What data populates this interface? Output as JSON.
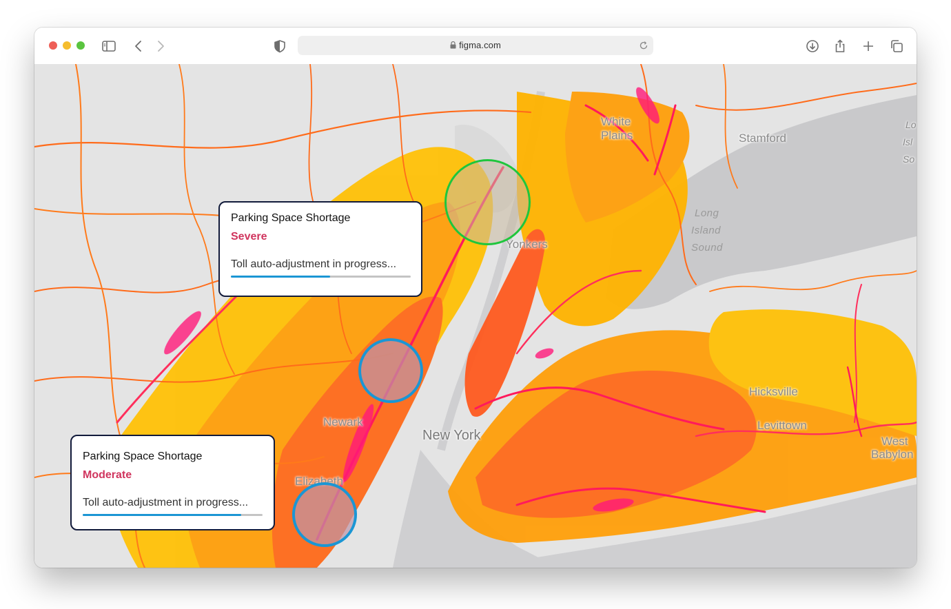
{
  "browser": {
    "url": "figma.com",
    "icons": [
      "sidebar-icon",
      "back-icon",
      "forward-icon",
      "shield-icon",
      "lock-icon",
      "reload-icon",
      "download-icon",
      "share-icon",
      "new-tab-icon",
      "tabs-icon"
    ]
  },
  "map": {
    "places": {
      "white_plains_1": "White",
      "white_plains_2": "Plains",
      "stamford": "Stamford",
      "yonkers": "Yonkers",
      "newark": "Newark",
      "new_york": "New York",
      "elizabeth": "Elizabeth",
      "hicksville": "Hicksville",
      "levittown": "Levittown",
      "west_babylon_1": "West",
      "west_babylon_2": "Babylon",
      "edge_1": "Lo",
      "edge_2": "Isl",
      "edge_3": "So"
    },
    "water": {
      "lis_1": "Long",
      "lis_2": "Island",
      "lis_3": "Sound"
    },
    "colors": {
      "low": "#ffcc00",
      "mid": "#ff9800",
      "high": "#ff5a1f",
      "peak": "#ff1a5c",
      "marker_ok": "#1fc63d",
      "marker_alert": "#1b96d4"
    }
  },
  "cards": [
    {
      "title": "Parking Space Shortage",
      "severity": "Severe",
      "status": "Toll auto-adjustment in progress...",
      "progress": 0.55
    },
    {
      "title": "Parking Space Shortage",
      "severity": "Moderate",
      "status": "Toll auto-adjustment in progress...",
      "progress": 0.88
    }
  ]
}
